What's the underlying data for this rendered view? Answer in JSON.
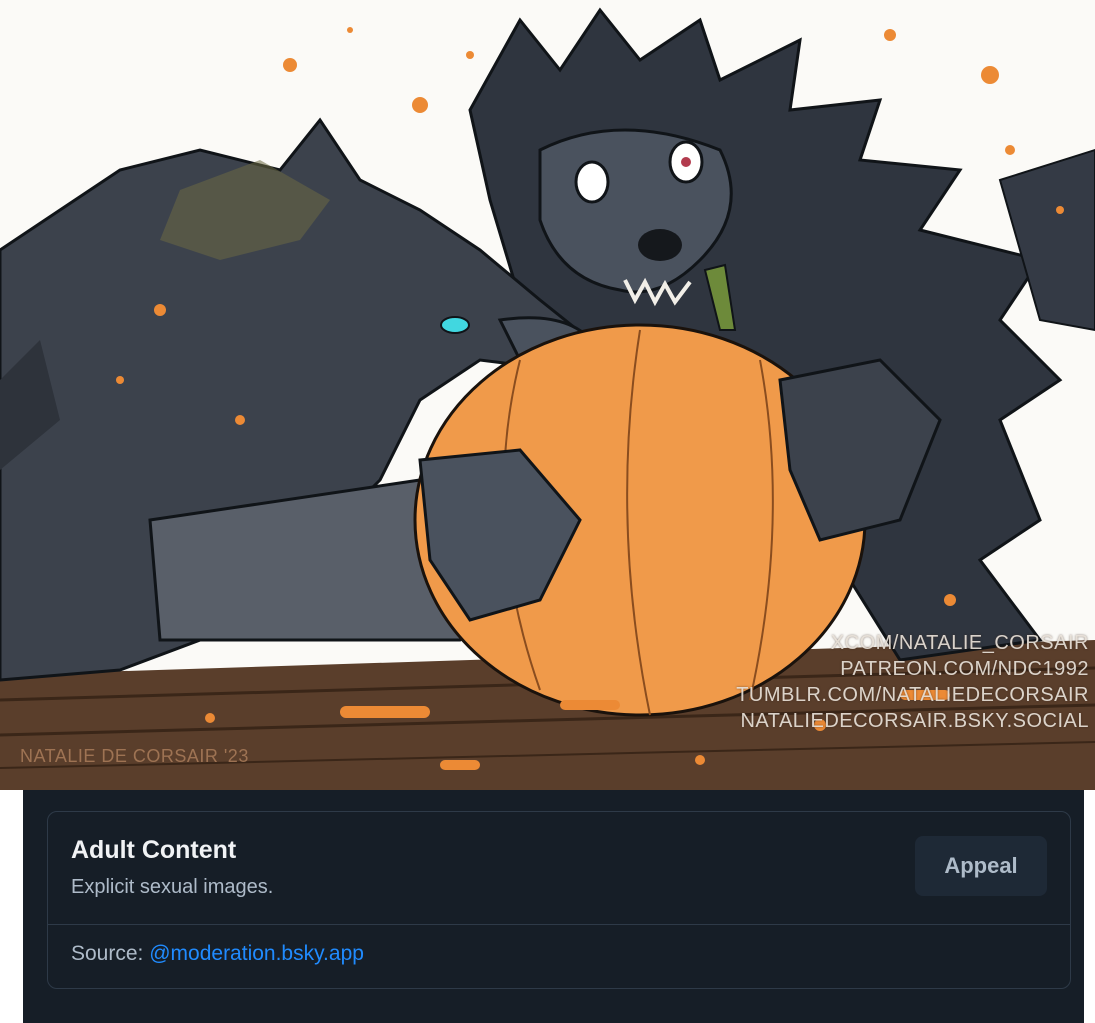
{
  "artwork": {
    "signature": "NATALIE DE CORSAIR '23",
    "watermarks": [
      "XCOM/NATALIE_CORSAIR",
      "PATREON.COM/NDC1992",
      "TUMBLR.COM/NATALIEDECORSAIR",
      "NATALIEDECORSAIR.BSKY.SOCIAL"
    ]
  },
  "moderation": {
    "title": "Adult Content",
    "description": "Explicit sexual images.",
    "appeal_label": "Appeal",
    "source_prefix": "Source: ",
    "source_handle": "@moderation.bsky.app"
  },
  "colors": {
    "panel_bg": "#161e27",
    "link": "#208bfe",
    "pumpkin": "#f09a4a",
    "wolf_dark": "#2f353f",
    "wolf_mid": "#4a525e"
  }
}
